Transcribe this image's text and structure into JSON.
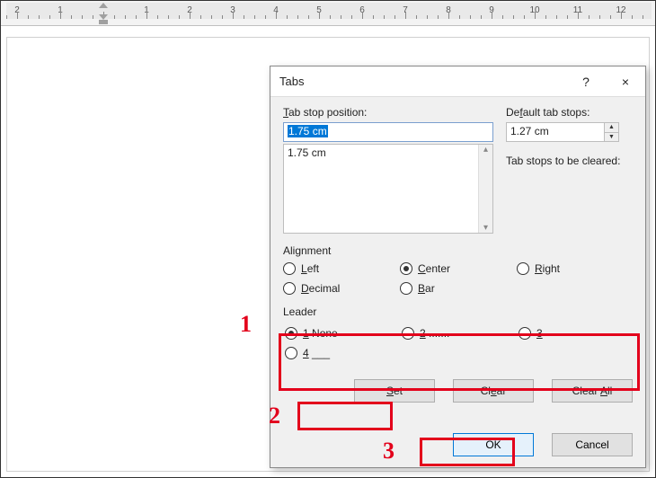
{
  "ruler": {
    "numbers": [
      "2",
      "1",
      "1",
      "2",
      "3",
      "4",
      "5",
      "6",
      "7",
      "8",
      "9",
      "10",
      "11",
      "12"
    ]
  },
  "dialog": {
    "title": "Tabs",
    "help": "?",
    "close": "×",
    "tab_stop_position_label": "Tab stop position:",
    "tab_stop_position_label_key": "T",
    "tab_stop_input_value": "1.75 cm",
    "tab_stop_list": [
      "1.75 cm"
    ],
    "default_tab_stops_label": "Default tab stops:",
    "default_tab_stops_label_key": "f",
    "default_tab_stops_value": "1.27 cm",
    "to_be_cleared_label": "Tab stops to be cleared:",
    "alignment_label": "Alignment",
    "alignment": {
      "left": "Left",
      "left_key": "L",
      "center": "Center",
      "center_key": "C",
      "right": "Right",
      "right_key": "R",
      "decimal": "Decimal",
      "decimal_key": "D",
      "bar": "Bar",
      "bar_key": "B",
      "selected": "center"
    },
    "leader_label": "Leader",
    "leader": {
      "opt1": "1 None",
      "opt1_key": "1",
      "opt2": "2 .......",
      "opt2_key": "2",
      "opt3": "3 -------",
      "opt3_key": "3",
      "opt4": "4 ___",
      "opt4_key": "4",
      "selected": "1"
    },
    "buttons": {
      "set": "Set",
      "set_key": "S",
      "clear": "Clear",
      "clear_key": "e",
      "clear_all": "Clear All",
      "clear_all_key": "A",
      "ok": "OK",
      "cancel": "Cancel"
    }
  },
  "annotations": {
    "n1": "1",
    "n2": "2",
    "n3": "3"
  }
}
